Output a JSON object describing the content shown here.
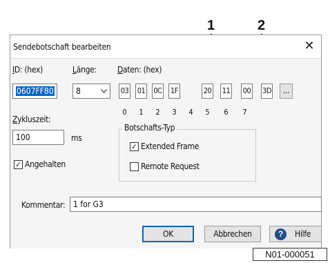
{
  "dialog": {
    "title": "Sendebotschaft bearbeiten",
    "close_glyph": "✕"
  },
  "labels": {
    "id_hex_prefix": "I",
    "id_hex_rest": "D: (hex)",
    "laenge_prefix": "L",
    "laenge_rest": "änge:",
    "daten_prefix": "D",
    "daten_rest": "aten: (hex)",
    "zykluszeit_prefix": "Z",
    "zykluszeit_rest": "ykluszeit:",
    "ms": "ms",
    "botschafts_typ": "Botschafts-Typ",
    "kommentar_prefix": "Kommentar:"
  },
  "fields": {
    "id_value": "0607FF80",
    "laenge_value": "8",
    "zykluszeit_value": "100",
    "kommentar_value": "1 for G3"
  },
  "data_bytes": [
    "03",
    "01",
    "0C",
    "1F",
    "20",
    "11",
    "00",
    "3D"
  ],
  "byte_indices": [
    "0",
    "1",
    "2",
    "3",
    "4",
    "5",
    "6",
    "7"
  ],
  "more_button": "...",
  "checkboxes": {
    "angehalten": {
      "label": "Angehalten",
      "checked": true
    },
    "extended_frame": {
      "label": "Extended Frame",
      "checked": true
    },
    "remote_request": {
      "label": "Remote Request",
      "checked": false
    }
  },
  "buttons": {
    "ok": "OK",
    "abbrechen": "Abbrechen",
    "hilfe": "Hilfe",
    "help_icon_glyph": "?"
  },
  "callouts": {
    "one": "1",
    "two": "2"
  },
  "figure_code": "N01-000051",
  "colors": {
    "selection": "#0a64c8",
    "help_icon": "#1f4e8c"
  }
}
